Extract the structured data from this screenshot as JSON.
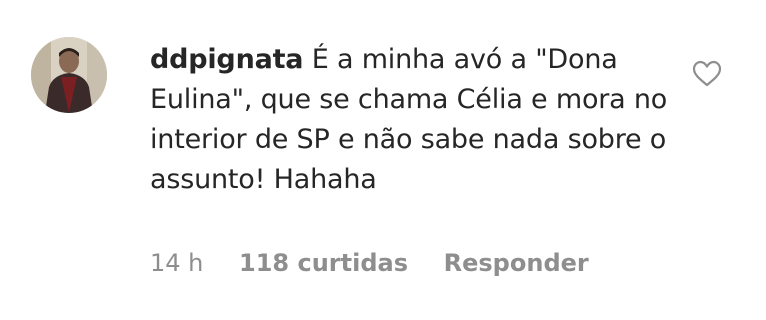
{
  "comment": {
    "username": "ddpignata",
    "text": "É a minha avó a \"Dona Eulina\", que se chama Célia e mora no interior de SP e não sabe nada sobre o assunto! Hahaha",
    "time": "14 h",
    "likes": "118 curtidas",
    "reply_label": "Responder",
    "icons": {
      "avatar": "profile-photo",
      "like": "heart-outline-icon"
    }
  },
  "colors": {
    "text": "#262626",
    "meta": "#8e8e8e",
    "icon": "#8e8e8e",
    "background": "#ffffff"
  }
}
